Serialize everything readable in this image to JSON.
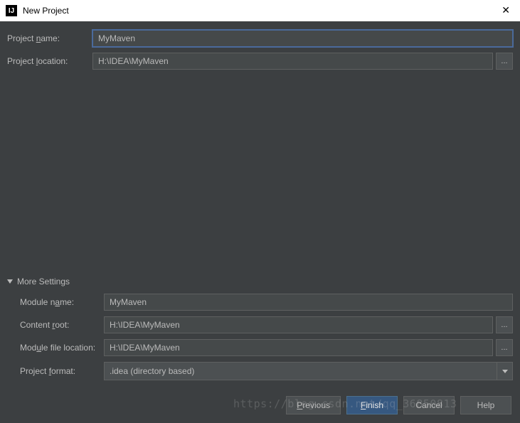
{
  "window": {
    "title": "New Project",
    "icon_text": "IJ"
  },
  "fields": {
    "project_name_label": "Project name:",
    "project_name_underline": "n",
    "project_name_value": "MyMaven",
    "project_location_label": "Project location:",
    "project_location_underline": "l",
    "project_location_value": "H:\\IDEA\\MyMaven"
  },
  "more_settings": {
    "header": "More Settings",
    "module_name_label": "Module name:",
    "module_name_underline": "a",
    "module_name_value": "MyMaven",
    "content_root_label": "Content root:",
    "content_root_underline": "r",
    "content_root_value": "H:\\IDEA\\MyMaven",
    "module_file_location_label": "Module file location:",
    "module_file_location_underline": "",
    "module_file_location_value": "H:\\IDEA\\MyMaven",
    "project_format_label": "Project format:",
    "project_format_underline": "f",
    "project_format_value": ".idea (directory based)"
  },
  "buttons": {
    "previous": "Previous",
    "finish": "Finish",
    "cancel": "Cancel",
    "help": "Help"
  },
  "browse": "...",
  "watermark": "https://blog.csdn.net/qq_36850813"
}
